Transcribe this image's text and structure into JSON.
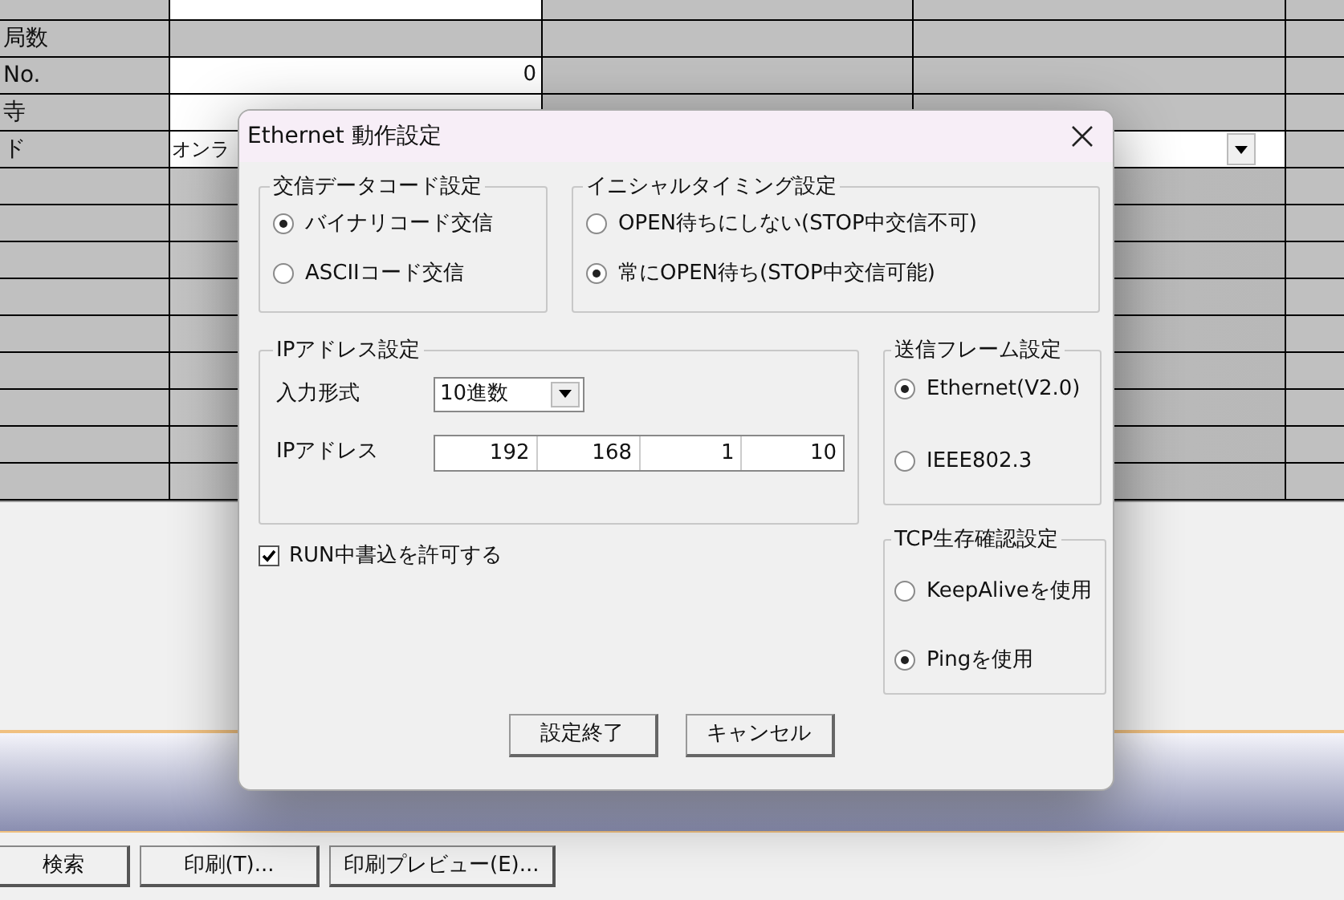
{
  "sheet": {
    "rows": [
      {
        "kind": "input"
      },
      {
        "label": "局数",
        "kind": "blank"
      },
      {
        "label": "No.",
        "kind": "input",
        "value": "0"
      },
      {
        "label": "寺",
        "kind": "input"
      },
      {
        "label": "ド",
        "kind": "dropdown",
        "value": "オンラ"
      }
    ]
  },
  "bottom_buttons": [
    "検索",
    "印刷(T)...",
    "印刷プレビュー(E)..."
  ],
  "dialog": {
    "title": "Ethernet 動作設定",
    "data_code": {
      "title": "交信データコード設定",
      "options": [
        {
          "label": "バイナリコード交信",
          "selected": true
        },
        {
          "label": "ASCIIコード交信",
          "selected": false
        }
      ]
    },
    "initial_timing": {
      "title": "イニシャルタイミング設定",
      "options": [
        {
          "label": "OPEN待ちにしない(STOP中交信不可)",
          "selected": false
        },
        {
          "label": "常にOPEN待ち(STOP中交信可能)",
          "selected": true
        }
      ]
    },
    "ip": {
      "title": "IPアドレス設定",
      "format_label": "入力形式",
      "format_value": "10進数",
      "address_label": "IPアドレス",
      "octets": [
        "192",
        "168",
        "1",
        "10"
      ]
    },
    "frame": {
      "title": "送信フレーム設定",
      "options": [
        {
          "label": "Ethernet(V2.0)",
          "selected": true
        },
        {
          "label": "IEEE802.3",
          "selected": false
        }
      ]
    },
    "run_write": {
      "label": "RUN中書込を許可する",
      "checked": true
    },
    "tcp": {
      "title": "TCP生存確認設定",
      "options": [
        {
          "label": "KeepAliveを使用",
          "selected": false
        },
        {
          "label": "Pingを使用",
          "selected": true
        }
      ]
    },
    "buttons": [
      "設定終了",
      "キャンセル"
    ]
  }
}
